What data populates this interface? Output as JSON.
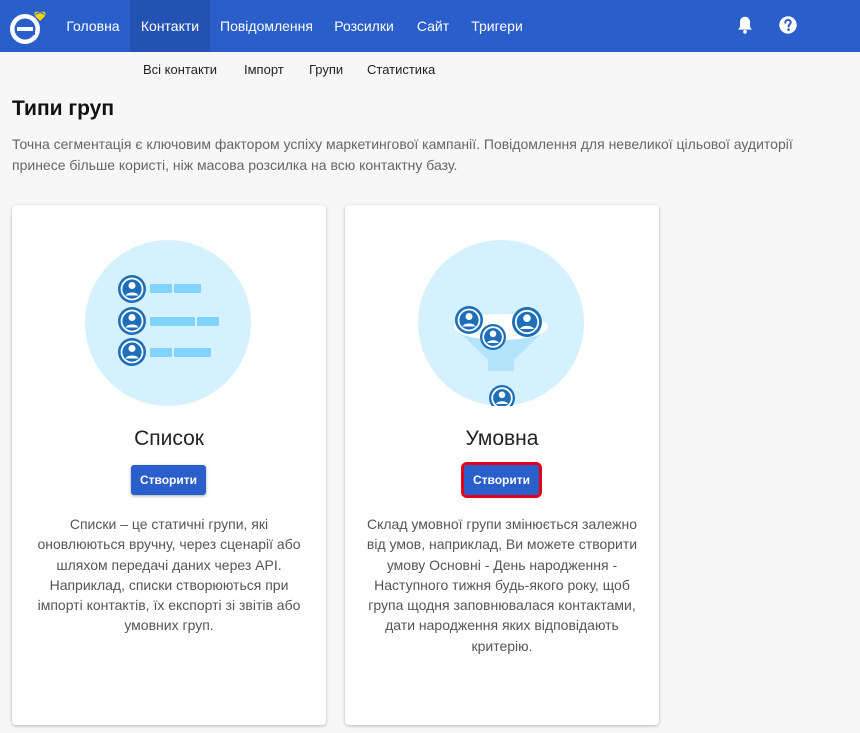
{
  "nav": {
    "items": [
      {
        "label": "Головна"
      },
      {
        "label": "Контакти",
        "active": true
      },
      {
        "label": "Повідомлення"
      },
      {
        "label": "Розсилки"
      },
      {
        "label": "Сайт"
      },
      {
        "label": "Тригери"
      }
    ],
    "icons": [
      "bell-icon",
      "help-icon"
    ]
  },
  "subnav": {
    "items": [
      {
        "label": "Всі контакти"
      },
      {
        "label": "Імпорт"
      },
      {
        "label": "Групи"
      },
      {
        "label": "Статистика"
      }
    ]
  },
  "page": {
    "title": "Типи груп",
    "description": "Точна сегментація є ключовим фактором успіху маркетингової кампанії. Повідомлення для невеликої цільової аудиторії принесе більше користі, ніж масова розсилка на всю контактну базу."
  },
  "cards": [
    {
      "title": "Список",
      "button": "Створити",
      "description": "Списки – це статичні групи, які оновлюються вручну, через сценарії або шляхом передачі даних через API. Наприклад, списки створюються при імпорті контактів, їх експорті зі звітів або умовних груп."
    },
    {
      "title": "Умовна",
      "button": "Створити",
      "highlighted": true,
      "description": "Склад умовної групи змінюється залежно від умов, наприклад, Ви можете створити умову Основні - День народження - Наступного тижня будь-якого року, щоб група щодня заповнювалася контактами, дати народження яких відповідають критерію."
    }
  ],
  "colors": {
    "header": "#2a5ecb",
    "active_tab": "#2452b3",
    "button": "#2a5ecb",
    "highlight_border": "#e3001b",
    "illustration_bg": "#d4f1fd",
    "avatar": "#1c6fb8"
  }
}
